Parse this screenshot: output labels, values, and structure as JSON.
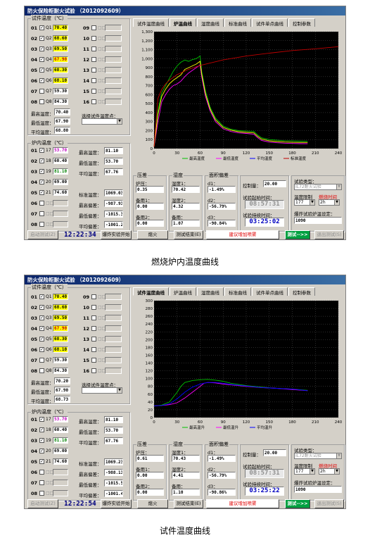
{
  "app_title": "防火保险柜耐火试验 （2012092609）",
  "tabs": [
    "试件温度曲线",
    "炉温曲线",
    "湿度曲线",
    "标准曲线",
    "试件单点曲线",
    "控制参数"
  ],
  "sample_temp_group": "试件温度（℃）",
  "furnace_temp_group": "炉内温度（℃）",
  "sample_channels": [
    {
      "num": "01",
      "checked": true,
      "name": "Q1",
      "value": "70.40"
    },
    {
      "num": "02",
      "checked": true,
      "name": "Q2",
      "value": "68.60"
    },
    {
      "num": "03",
      "checked": true,
      "name": "Q3",
      "value": "69.50"
    },
    {
      "num": "04",
      "checked": true,
      "name": "Q4",
      "value": "67.90"
    },
    {
      "num": "05",
      "checked": true,
      "name": "Q5",
      "value": "68.30"
    },
    {
      "num": "06",
      "checked": true,
      "name": "Q6",
      "value": "68.10"
    },
    {
      "num": "07",
      "checked": false,
      "name": "Q7",
      "value": "59.30"
    },
    {
      "num": "08",
      "checked": false,
      "name": "Q8",
      "value": "84.30"
    }
  ],
  "sample_channels_b": [
    "09",
    "10",
    "11",
    "12",
    "13",
    "14",
    "15",
    "16"
  ],
  "sample_channels_b_name": "□□",
  "sample_stats_labels": [
    "最高温度：",
    "最低温度：",
    "平均温度："
  ],
  "sample_stats_1": [
    "70.40",
    "67.90",
    "68.80"
  ],
  "sample_stats_2": [
    "70.20",
    "67.90",
    "68.73"
  ],
  "select_sample_label": "选择试件温度点：",
  "furnace_channels": [
    {
      "num": "01",
      "checked": true,
      "name": "17",
      "value": "53.70"
    },
    {
      "num": "02",
      "checked": true,
      "name": "18",
      "value": "60.40"
    },
    {
      "num": "03",
      "checked": true,
      "name": "19",
      "value": "81.10"
    },
    {
      "num": "04",
      "checked": true,
      "name": "20",
      "value": "69.00"
    },
    {
      "num": "05",
      "checked": true,
      "name": "21",
      "value": "74.60"
    },
    {
      "num": "06",
      "checked": false,
      "name": "□□",
      "value": ""
    },
    {
      "num": "07",
      "checked": false,
      "name": "□□",
      "value": ""
    },
    {
      "num": "08",
      "checked": false,
      "name": "□□",
      "value": ""
    }
  ],
  "furnace_stats_labels": [
    "最高温度：",
    "最低温度：",
    "平均温度："
  ],
  "furnace_stats": [
    "81.10",
    "53.70",
    "67.76"
  ],
  "std_labels": [
    "标准温度：",
    "最高偏差：",
    "最低偏差：",
    "平均偏差："
  ],
  "std_values_1": [
    "1069.03",
    "-987.93",
    "-1015.33",
    "-1001.27"
  ],
  "std_values_2": [
    "1069.23",
    "-988.13",
    "-1015.53",
    "-1001.47"
  ],
  "pressure": {
    "title": "压差",
    "label1": "炉压：",
    "label2": "备用1：",
    "label3": "备用2：",
    "v1_a": "0.35",
    "v1_b": "0.61",
    "v2": "0.00",
    "v3": "0.00"
  },
  "humidity": {
    "title": "湿度",
    "label1": "湿度1：",
    "label2": "湿度2：",
    "label3": "备用：",
    "a": [
      "70.42",
      "4.32",
      "1.07"
    ],
    "b": [
      "70.43",
      "4.41",
      "1.10"
    ]
  },
  "area": {
    "title": "面积偏差",
    "l1": "d1：",
    "l2": "d2：",
    "l3": "d3：",
    "v": [
      "-1.49%",
      "-56.79%",
      "-90.84%"
    ],
    "v_b": [
      "-1.49%",
      "-56.79%",
      "-90.86%"
    ]
  },
  "control": {
    "label": "控制量：",
    "value": "20.00",
    "start_label": "试验起始时间：",
    "start_time": "08:57:31",
    "elapsed_label": "试验持续时间：",
    "elapsed_1": "03:25:02",
    "elapsed_2": "03:25:22"
  },
  "test_type": {
    "label": "试验类型：",
    "value": "IL72耐火试验",
    "limit_label": "温度限制",
    "time_label": "燃烧时间",
    "limit_value": "177",
    "time_value": "2h",
    "burn_label": "爆炸试验炉温设定：",
    "burn_value": "1090"
  },
  "buttons": {
    "start": "启动测试(Z)",
    "clock_1": "12:22:34",
    "clock_2": "12:22:54",
    "open_exp": "爆炸实验开始",
    "fire": "熄火",
    "end": "测试结束(E)",
    "hint": "建议增加喷雾",
    "test": "测试-->>",
    "exit": "退出测试(S)"
  },
  "legend_1": [
    "最高温度",
    "最低温度",
    "平均温度",
    "标准温度"
  ],
  "legend_2": [
    "最高温升",
    "最低温升",
    "平均温升"
  ],
  "caption_1": "燃烧炉内温度曲线",
  "caption_2": "试件温度曲线",
  "chart_data": [
    {
      "type": "line",
      "xlim": [
        0,
        240
      ],
      "ylim": [
        0,
        1300
      ],
      "x_ticks": [
        0,
        30,
        60,
        90,
        120,
        150,
        180,
        210,
        240
      ],
      "y_ticks": [
        0,
        100,
        200,
        300,
        400,
        500,
        600,
        700,
        800,
        900,
        1000,
        1100,
        1200,
        1300
      ],
      "legend": [
        "最高温度",
        "最低温度",
        "平均温度",
        "标准温度"
      ],
      "series": [
        {
          "name": "最高温度",
          "color": "#00c000",
          "points": [
            [
              0,
              20
            ],
            [
              5,
              420
            ],
            [
              10,
              620
            ],
            [
              15,
              700
            ],
            [
              20,
              780
            ],
            [
              25,
              860
            ],
            [
              30,
              920
            ],
            [
              35,
              960
            ],
            [
              40,
              985
            ],
            [
              45,
              970
            ],
            [
              50,
              990
            ],
            [
              55,
              1000
            ],
            [
              60,
              1030
            ],
            [
              62,
              860
            ],
            [
              67,
              640
            ],
            [
              73,
              460
            ],
            [
              80,
              340
            ],
            [
              90,
              250
            ],
            [
              100,
              215
            ],
            [
              110,
              200
            ],
            [
              120,
              195
            ],
            [
              130,
              190
            ],
            [
              135,
              150
            ],
            [
              140,
              120
            ],
            [
              150,
              100
            ],
            [
              160,
              93
            ],
            [
              170,
              88
            ],
            [
              180,
              85
            ],
            [
              190,
              82
            ],
            [
              200,
              81
            ]
          ]
        },
        {
          "name": "最低温度",
          "color": "#ff00ff",
          "points": [
            [
              0,
              20
            ],
            [
              5,
              300
            ],
            [
              10,
              520
            ],
            [
              15,
              600
            ],
            [
              20,
              660
            ],
            [
              25,
              700
            ],
            [
              30,
              720
            ],
            [
              35,
              750
            ],
            [
              40,
              800
            ],
            [
              45,
              840
            ],
            [
              50,
              870
            ],
            [
              55,
              900
            ],
            [
              60,
              930
            ],
            [
              62,
              800
            ],
            [
              67,
              580
            ],
            [
              73,
              420
            ],
            [
              80,
              300
            ],
            [
              90,
              220
            ],
            [
              100,
              190
            ],
            [
              110,
              175
            ],
            [
              120,
              168
            ],
            [
              130,
              160
            ],
            [
              135,
              120
            ],
            [
              140,
              90
            ],
            [
              150,
              72
            ],
            [
              160,
              65
            ],
            [
              170,
              60
            ],
            [
              180,
              57
            ],
            [
              190,
              55
            ],
            [
              200,
              54
            ]
          ]
        },
        {
          "name": "平均温度",
          "color": "#ffff00",
          "points": [
            [
              0,
              20
            ],
            [
              5,
              380
            ],
            [
              10,
              580
            ],
            [
              15,
              660
            ],
            [
              20,
              720
            ],
            [
              25,
              760
            ],
            [
              30,
              790
            ],
            [
              35,
              820
            ],
            [
              40,
              880
            ],
            [
              45,
              900
            ],
            [
              50,
              920
            ],
            [
              55,
              940
            ],
            [
              60,
              970
            ],
            [
              62,
              830
            ],
            [
              67,
              610
            ],
            [
              73,
              440
            ],
            [
              80,
              320
            ],
            [
              90,
              235
            ],
            [
              100,
              205
            ],
            [
              110,
              188
            ],
            [
              120,
              180
            ],
            [
              130,
              175
            ],
            [
              135,
              135
            ],
            [
              140,
              105
            ],
            [
              150,
              86
            ],
            [
              160,
              78
            ],
            [
              170,
              73
            ],
            [
              180,
              70
            ],
            [
              190,
              68
            ],
            [
              200,
              68
            ]
          ]
        },
        {
          "name": "标准温度",
          "color": "#c00000",
          "points": [
            [
              0,
              20
            ],
            [
              5,
              556
            ],
            [
              10,
              659
            ],
            [
              15,
              719
            ],
            [
              20,
              761
            ],
            [
              30,
              822
            ],
            [
              45,
              882
            ],
            [
              60,
              925
            ],
            [
              90,
              986
            ],
            [
              120,
              1029
            ],
            [
              150,
              1061
            ],
            [
              180,
              1090
            ],
            [
              210,
              1110
            ],
            [
              240,
              1133
            ]
          ]
        }
      ]
    },
    {
      "type": "line",
      "xlim": [
        0,
        240
      ],
      "ylim": [
        0,
        300
      ],
      "x_ticks": [
        0,
        30,
        60,
        90,
        120,
        150,
        180,
        210,
        240
      ],
      "y_ticks": [
        0,
        20,
        40,
        60,
        80,
        100,
        120,
        140,
        160,
        180,
        200,
        220,
        240,
        260,
        280,
        300
      ],
      "legend": [
        "最高温升",
        "最低温升",
        "平均温升"
      ],
      "series": [
        {
          "name": "最高温升",
          "color": "#00c000",
          "points": [
            [
              0,
              30
            ],
            [
              10,
              32
            ],
            [
              20,
              40
            ],
            [
              30,
              65
            ],
            [
              35,
              80
            ],
            [
              40,
              90
            ],
            [
              50,
              95
            ],
            [
              60,
              97
            ],
            [
              70,
              98
            ],
            [
              80,
              96
            ],
            [
              90,
              93
            ],
            [
              100,
              88
            ],
            [
              120,
              82
            ],
            [
              140,
              78
            ],
            [
              160,
              75
            ],
            [
              180,
              73
            ],
            [
              200,
              70
            ]
          ]
        },
        {
          "name": "最低温升",
          "color": "#ff00ff",
          "points": [
            [
              0,
              30
            ],
            [
              10,
              31
            ],
            [
              20,
              33
            ],
            [
              30,
              38
            ],
            [
              40,
              50
            ],
            [
              50,
              65
            ],
            [
              60,
              80
            ],
            [
              65,
              88
            ],
            [
              70,
              90
            ],
            [
              80,
              89
            ],
            [
              90,
              86
            ],
            [
              100,
              84
            ],
            [
              120,
              80
            ],
            [
              140,
              77
            ],
            [
              160,
              75
            ],
            [
              180,
              72
            ],
            [
              200,
              69
            ]
          ]
        },
        {
          "name": "平均温升",
          "color": "#0000ff",
          "points": [
            [
              0,
              30
            ],
            [
              10,
              31
            ],
            [
              20,
              35
            ],
            [
              30,
              48
            ],
            [
              40,
              65
            ],
            [
              50,
              78
            ],
            [
              60,
              86
            ],
            [
              70,
              90
            ],
            [
              80,
              90
            ],
            [
              90,
              88
            ],
            [
              100,
              85
            ],
            [
              120,
              81
            ],
            [
              140,
              77
            ],
            [
              160,
              75
            ],
            [
              180,
              73
            ],
            [
              200,
              69
            ]
          ]
        }
      ]
    }
  ]
}
